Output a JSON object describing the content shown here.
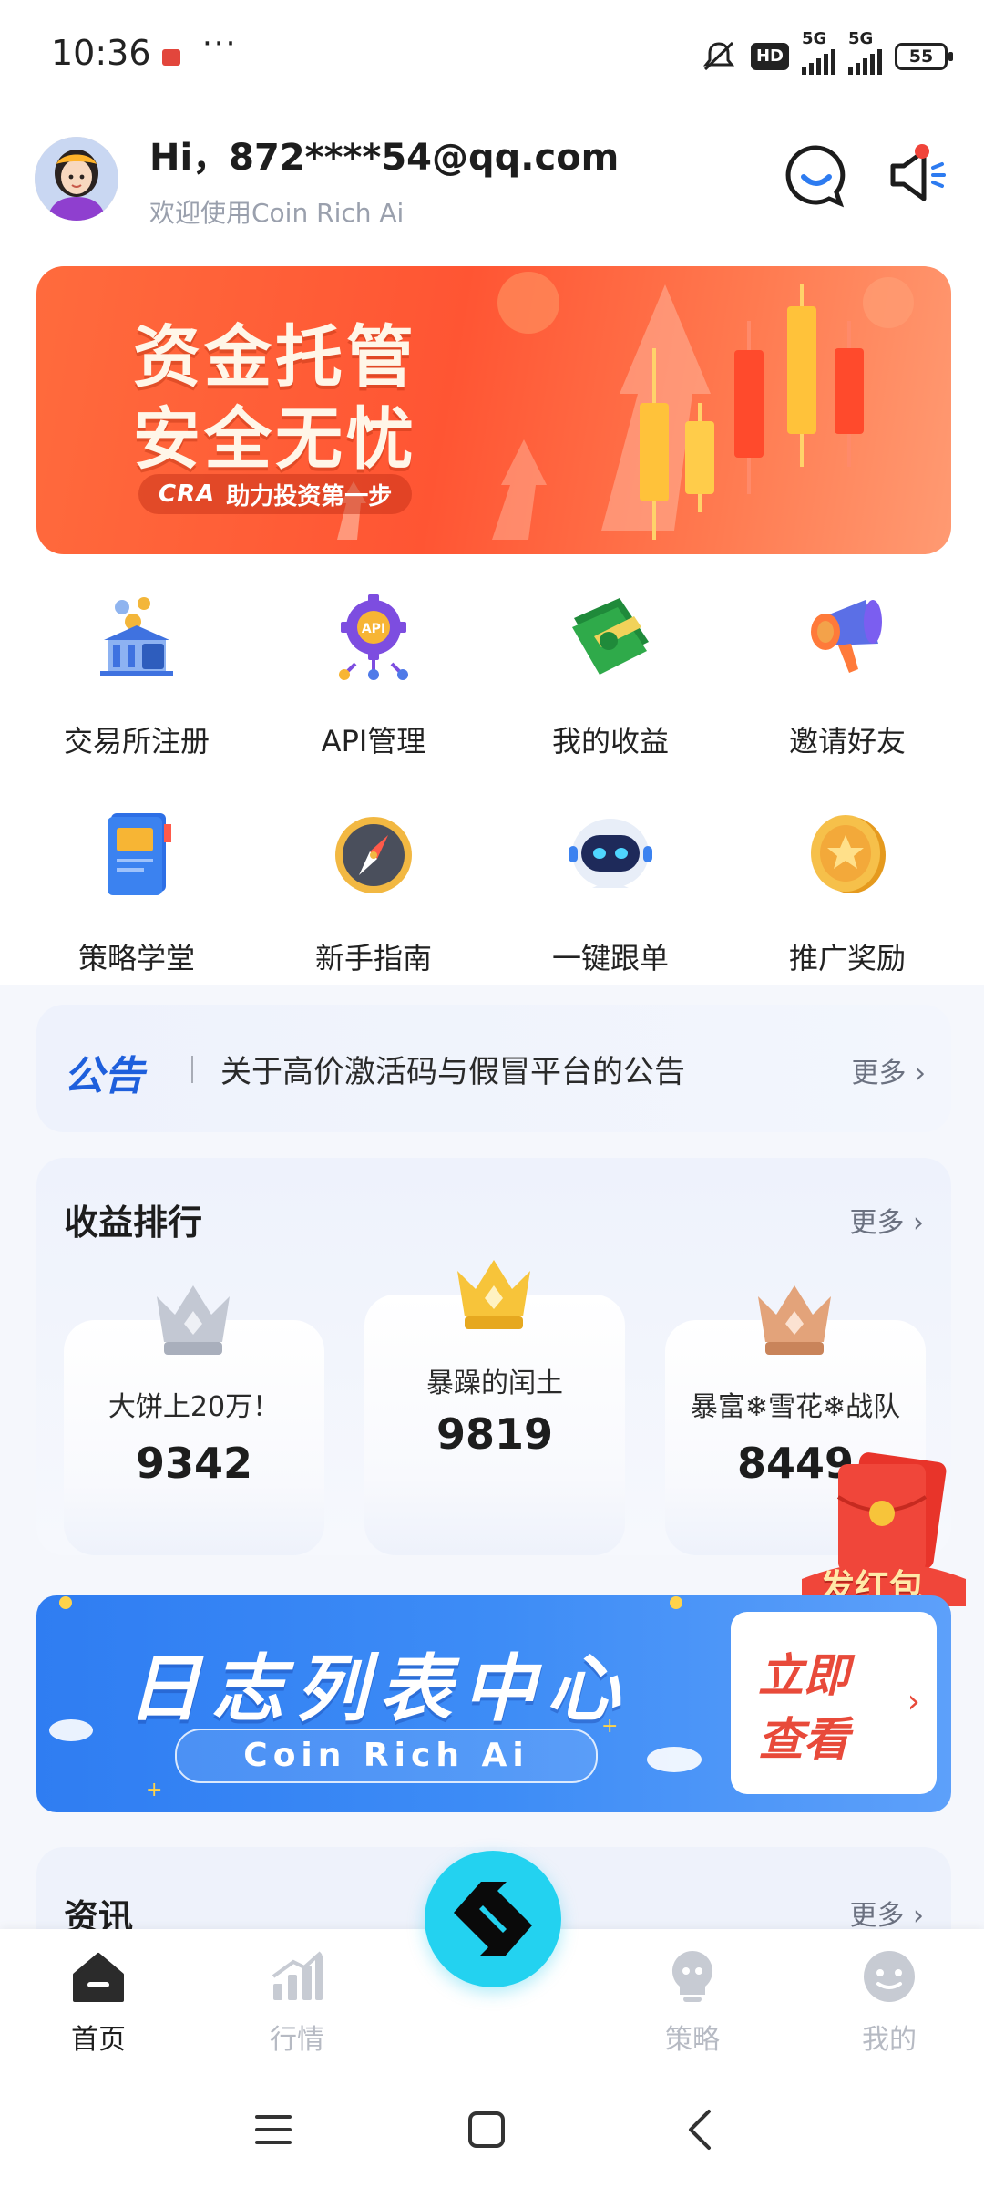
{
  "status_bar": {
    "time": "10:36",
    "more": "···",
    "hd_badge": "HD",
    "network_1": "5G",
    "network_2": "5G",
    "battery": "55"
  },
  "header": {
    "greeting": "Hi，872****54@qq.com",
    "subtitle": "欢迎使用Coin Rich Ai"
  },
  "banner": {
    "line1": "资金托管",
    "line2": "安全无忧",
    "logo": "CRA",
    "slogan": "助力投资第一步"
  },
  "grid": [
    {
      "label": "交易所注册",
      "icon": "exchange-building-icon"
    },
    {
      "label": "API管理",
      "icon": "api-gear-icon"
    },
    {
      "label": "我的收益",
      "icon": "money-stack-icon"
    },
    {
      "label": "邀请好友",
      "icon": "megaphone-icon"
    },
    {
      "label": "策略学堂",
      "icon": "book-icon"
    },
    {
      "label": "新手指南",
      "icon": "compass-icon"
    },
    {
      "label": "一键跟单",
      "icon": "robot-icon"
    },
    {
      "label": "推广奖励",
      "icon": "star-coin-icon"
    }
  ],
  "notice": {
    "tag": "公告",
    "text": "关于高价激活码与假冒平台的公告",
    "more": "更多"
  },
  "ranking": {
    "title": "收益排行",
    "more": "更多",
    "entries": [
      {
        "rank": 2,
        "name": "大饼上20万！",
        "score": "9342"
      },
      {
        "rank": 1,
        "name": "暴躁的闰土",
        "score": "9819"
      },
      {
        "rank": 3,
        "name": "暴富❄雪花❄战队",
        "score": "8449"
      }
    ]
  },
  "red_packet": {
    "label": "发红包"
  },
  "log_banner": {
    "title": "日志列表中心",
    "subtitle": "Coin Rich Ai",
    "cta_line1": "立即",
    "cta_line2": "查看"
  },
  "news": {
    "title": "资讯",
    "more": "更多"
  },
  "tabs": [
    {
      "label": "首页",
      "active": true
    },
    {
      "label": "行情",
      "active": false
    },
    {
      "label": "策略",
      "active": false
    },
    {
      "label": "我的",
      "active": false
    }
  ],
  "colors": {
    "accent_blue": "#1e5fdc",
    "banner_orange": "#ff5533",
    "fab_cyan": "#23d2f0",
    "cta_red": "#e84a3a"
  }
}
